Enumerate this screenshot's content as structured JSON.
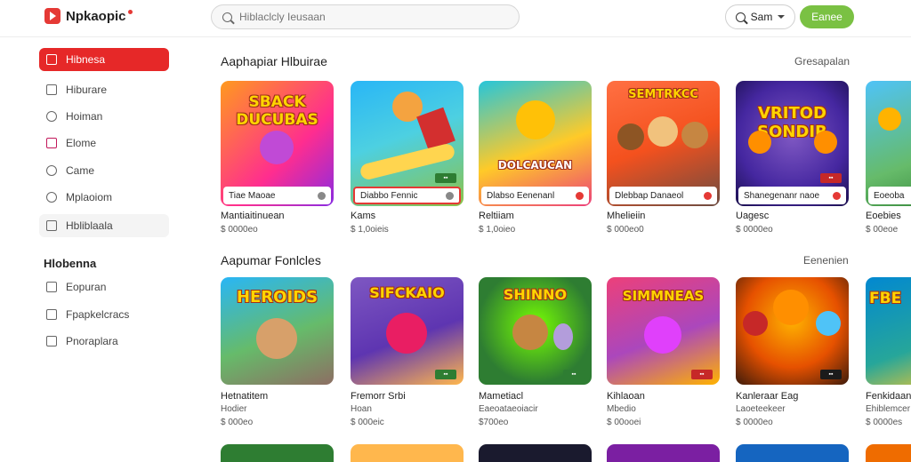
{
  "header": {
    "logo_text": "Npkaopic",
    "search_placeholder": "Hiblaclcly Ieusaan",
    "user_label": "Sam",
    "cta_label": "Eanee"
  },
  "sidebar": {
    "items": [
      {
        "label": "Hibnesa",
        "icon": "grid-icon"
      },
      {
        "label": "Hiburare",
        "icon": "bag-icon"
      },
      {
        "label": "Hoiman",
        "icon": "game-icon"
      },
      {
        "label": "Elome",
        "icon": "instagram-icon"
      },
      {
        "label": "Came",
        "icon": "globe-icon"
      },
      {
        "label": "Mplaoiom",
        "icon": "circle-icon"
      },
      {
        "label": "Hbliblaala",
        "icon": "list-icon"
      }
    ],
    "section_head": "Hlobenna",
    "section_items": [
      {
        "label": "Eopuran",
        "icon": "square-icon"
      },
      {
        "label": "Fpapkelcracs",
        "icon": "image-icon"
      },
      {
        "label": "Pnoraplara",
        "icon": "check-icon"
      }
    ]
  },
  "section1": {
    "title": "Aaphapiar Hlbuirae",
    "link": "Gresapalan",
    "cards": [
      {
        "art": "SBACK DUCUBAS",
        "label": "Tiae Maoae",
        "title": "Mantiaitinuean",
        "price": "$ 0000eo"
      },
      {
        "art": "",
        "label": "Diabbo Fennic",
        "title": "Kams",
        "price": "$ 1,0oieis"
      },
      {
        "art": "DOLCAUCAN",
        "label": "Dlabso Eenenanl",
        "title": "Reltiiam",
        "price": "$ 1,0oieo"
      },
      {
        "art": "SEMTRKCC",
        "label": "Dlebbap Danaeol",
        "title": "Mhelieiin",
        "price": "$ 000eo0"
      },
      {
        "art": "VRITOD SONDIR",
        "label": "Shanegenanr naoe",
        "title": "Uagesc",
        "price": "$ 0000eo"
      },
      {
        "art": "",
        "label": "Eoeoba",
        "title": "Eoebies",
        "price": "$ 00eoe"
      }
    ]
  },
  "section2": {
    "title": "Aapumar Fonlcles",
    "link": "Eenenien",
    "cards": [
      {
        "art": "HEROIDS",
        "title": "Hetnatitem",
        "sub": "Hodier",
        "price": "$ 000eo"
      },
      {
        "art": "SIFCKAIO",
        "title": "Fremorr Srbi",
        "sub": "Hoan",
        "price": "$ 000eic"
      },
      {
        "art": "SHINNO",
        "title": "Mametiacl",
        "sub": "Eaeoataeoiacir",
        "price": "$700eo"
      },
      {
        "art": "SIMMNEAS",
        "title": "Kihlaoan",
        "sub": "Mbedio",
        "price": "$ 00ooei"
      },
      {
        "art": "",
        "title": "Kanleraar Eag",
        "sub": "Laoeteekeer",
        "price": "$ 0000eo"
      },
      {
        "art": "FBE",
        "title": "Fenkidaan",
        "sub": "Ehiblemcer",
        "price": "$ 0000es"
      }
    ]
  },
  "colors": {
    "accent": "#e62828",
    "cta": "#7ac143"
  }
}
